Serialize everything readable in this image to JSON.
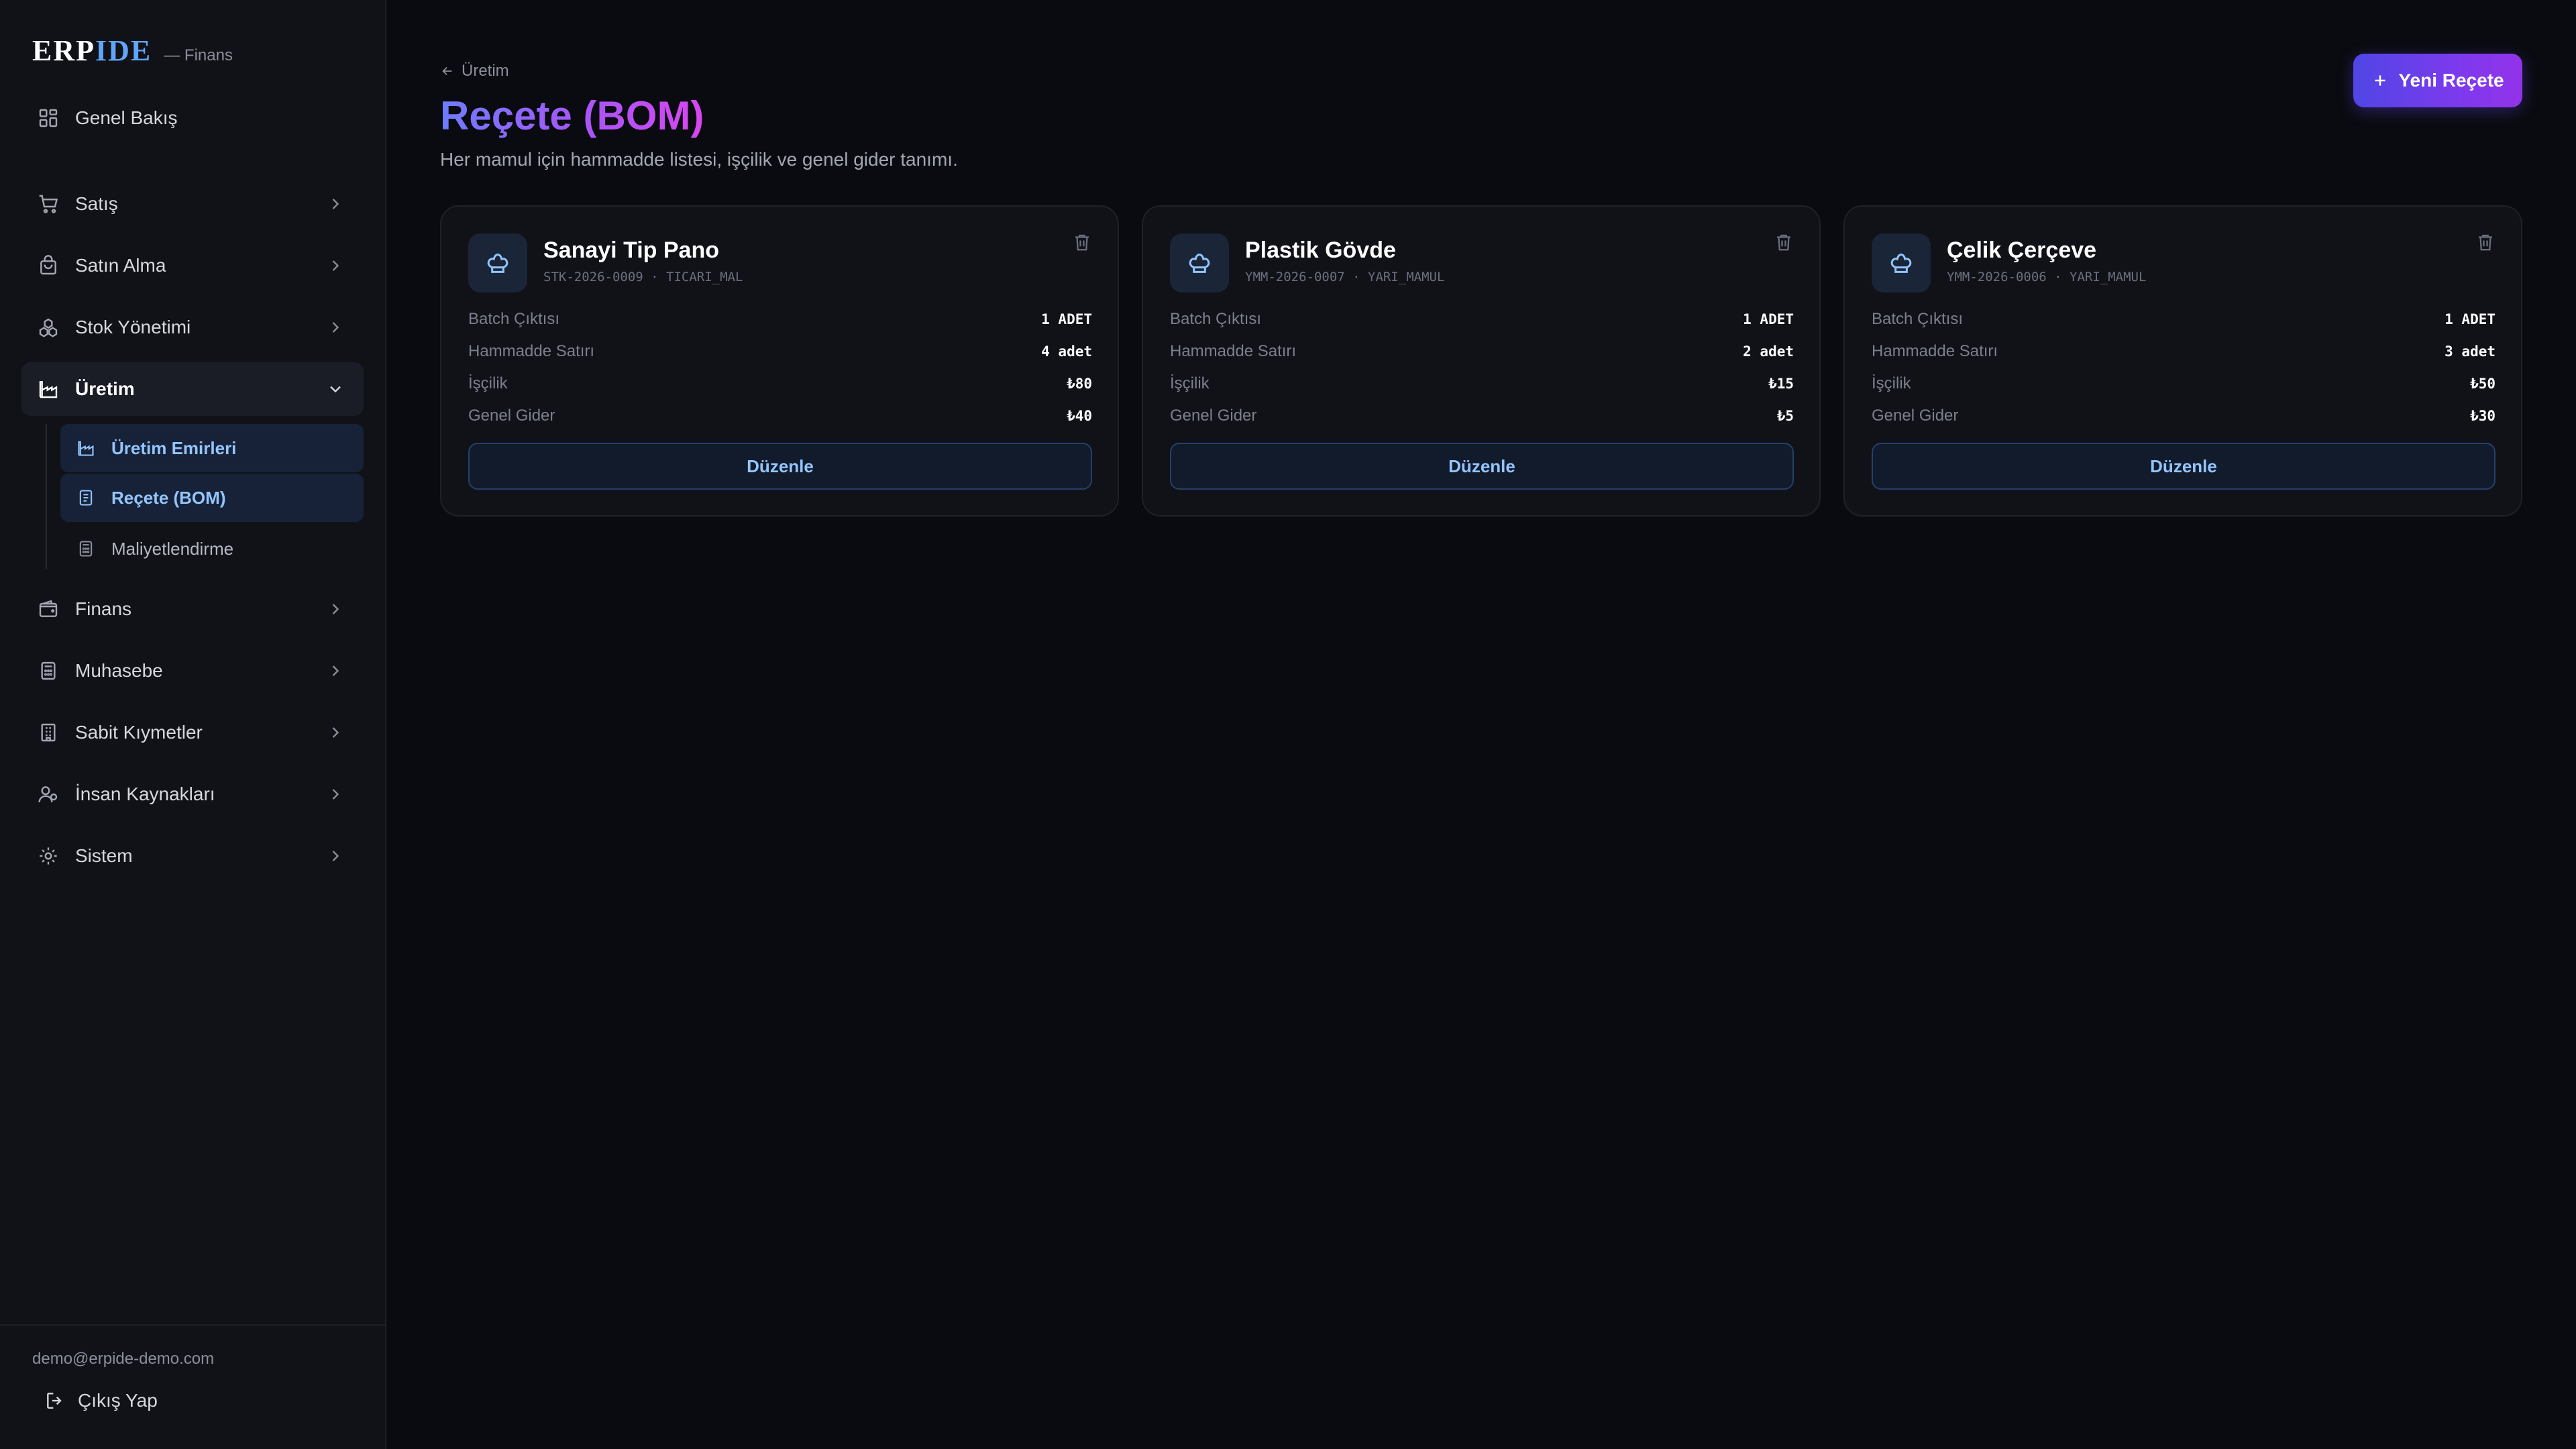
{
  "brand": {
    "logo_main": "ERP",
    "logo_accent": "IDE",
    "subtitle": "— Finans"
  },
  "sidebar": {
    "items": [
      {
        "label": "Genel Bakış"
      },
      {
        "label": "Satış"
      },
      {
        "label": "Satın Alma"
      },
      {
        "label": "Stok Yönetimi"
      },
      {
        "label": "Üretim"
      },
      {
        "label": "Finans"
      },
      {
        "label": "Muhasebe"
      },
      {
        "label": "Sabit Kıymetler"
      },
      {
        "label": "İnsan Kaynakları"
      },
      {
        "label": "Sistem"
      }
    ],
    "sub_items": [
      {
        "label": "Üretim Emirleri"
      },
      {
        "label": "Reçete (BOM)"
      },
      {
        "label": "Maliyetlendirme"
      }
    ],
    "user_email": "demo@erpide-demo.com",
    "logout_label": "Çıkış Yap"
  },
  "header": {
    "breadcrumb": "Üretim",
    "title": "Reçete (BOM)",
    "subtitle": "Her mamul için hammadde listesi, işçilik ve genel gider tanımı.",
    "new_button_label": "Yeni Reçete"
  },
  "cards": [
    {
      "title": "Sanayi Tip Pano",
      "code": "STK-2026-0009 · TICARI_MAL",
      "rows": [
        {
          "label": "Batch Çıktısı",
          "value": "1 ADET"
        },
        {
          "label": "Hammadde Satırı",
          "value": "4 adet"
        },
        {
          "label": "İşçilik",
          "value": "₺80"
        },
        {
          "label": "Genel Gider",
          "value": "₺40"
        }
      ],
      "edit_label": "Düzenle"
    },
    {
      "title": "Plastik Gövde",
      "code": "YMM-2026-0007 · YARI_MAMUL",
      "rows": [
        {
          "label": "Batch Çıktısı",
          "value": "1 ADET"
        },
        {
          "label": "Hammadde Satırı",
          "value": "2 adet"
        },
        {
          "label": "İşçilik",
          "value": "₺15"
        },
        {
          "label": "Genel Gider",
          "value": "₺5"
        }
      ],
      "edit_label": "Düzenle"
    },
    {
      "title": "Çelik Çerçeve",
      "code": "YMM-2026-0006 · YARI_MAMUL",
      "rows": [
        {
          "label": "Batch Çıktısı",
          "value": "1 ADET"
        },
        {
          "label": "Hammadde Satırı",
          "value": "3 adet"
        },
        {
          "label": "İşçilik",
          "value": "₺50"
        },
        {
          "label": "Genel Gider",
          "value": "₺30"
        }
      ],
      "edit_label": "Düzenle"
    }
  ],
  "colors": {
    "accent": "#60a5fa",
    "brand_gradient_start": "#6d7cff",
    "brand_gradient_end": "#d946ef",
    "background": "#0a0b10"
  },
  "icons": [
    "dashboard-icon",
    "cart-icon",
    "bag-icon",
    "boxes-icon",
    "factory-icon",
    "wallet-icon",
    "calculator-icon",
    "building-icon",
    "users-icon",
    "gear-icon",
    "chevron-right-icon",
    "chevron-down-icon",
    "trash-icon",
    "chef-hat-icon",
    "plus-icon",
    "arrow-left-icon",
    "logout-icon"
  ]
}
